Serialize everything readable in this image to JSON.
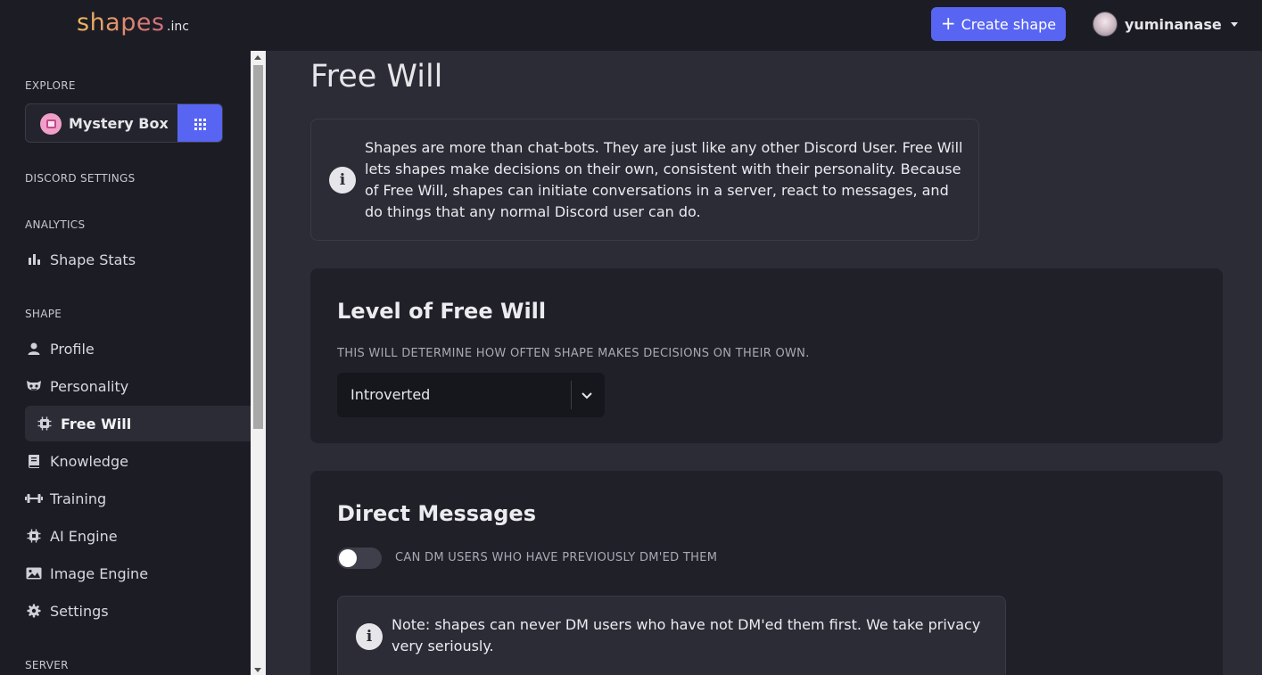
{
  "header": {
    "logo_text": "shapes",
    "logo_suffix": ".inc",
    "create_button_label": "Create shape",
    "username": "yuminanase"
  },
  "sidebar": {
    "explore_label": "EXPLORE",
    "mystery_box_label": "Mystery Box",
    "discord_settings_label": "DISCORD SETTINGS",
    "analytics_label": "ANALYTICS",
    "analytics_items": [
      {
        "label": "Shape Stats",
        "icon": "bar-chart-icon"
      }
    ],
    "shape_label": "SHAPE",
    "shape_items": [
      {
        "label": "Profile",
        "icon": "person-icon"
      },
      {
        "label": "Personality",
        "icon": "mask-icon"
      },
      {
        "label": "Free Will",
        "icon": "chip-icon",
        "active": true
      },
      {
        "label": "Knowledge",
        "icon": "book-icon"
      },
      {
        "label": "Training",
        "icon": "dumbbell-icon"
      },
      {
        "label": "AI Engine",
        "icon": "chip-icon"
      },
      {
        "label": "Image Engine",
        "icon": "image-icon"
      },
      {
        "label": "Settings",
        "icon": "gear-icon"
      }
    ],
    "server_label": "SERVER"
  },
  "main": {
    "title": "Free Will",
    "intro": "Shapes are more than chat-bots. They are just like any other Discord User. Free Will lets shapes make decisions on their own, consistent with their personality. Because of Free Will, shapes can initiate conversations in a server, react to messages, and do things that any normal Discord user can do.",
    "level_card": {
      "title": "Level of Free Will",
      "subtitle": "THIS WILL DETERMINE HOW OFTEN SHAPE MAKES DECISIONS ON THEIR OWN.",
      "selected_value": "Introverted"
    },
    "dm_card": {
      "title": "Direct Messages",
      "toggle_label": "CAN DM USERS WHO HAVE PREVIOUSLY DM'ED THEM",
      "toggle_on": false,
      "note": "Note: shapes can never DM users who have not DM'ed them first. We take privacy very seriously."
    }
  },
  "colors": {
    "accent": "#5865f2",
    "background": "#2b2c36",
    "sidebar": "#1c1d24",
    "card": "#1f2028"
  }
}
